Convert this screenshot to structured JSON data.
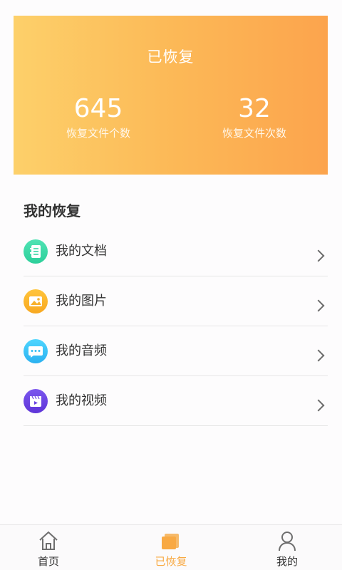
{
  "summary": {
    "title": "已恢复",
    "stats": [
      {
        "value": "645",
        "label": "恢复文件个数"
      },
      {
        "value": "32",
        "label": "恢复文件次数"
      }
    ]
  },
  "section": {
    "title": "我的恢复"
  },
  "menu": {
    "items": [
      {
        "label": "我的文档",
        "icon": "document-icon"
      },
      {
        "label": "我的图片",
        "icon": "image-icon"
      },
      {
        "label": "我的音频",
        "icon": "audio-icon"
      },
      {
        "label": "我的视频",
        "icon": "video-icon"
      }
    ]
  },
  "tabbar": {
    "tabs": [
      {
        "label": "首页",
        "icon": "home-icon"
      },
      {
        "label": "已恢复",
        "icon": "recovered-icon",
        "active": true
      },
      {
        "label": "我的",
        "icon": "user-icon"
      }
    ]
  },
  "colors": {
    "accent": "#f8a943",
    "card_gradient_start": "#fdd06a",
    "card_gradient_end": "#fca44d"
  }
}
